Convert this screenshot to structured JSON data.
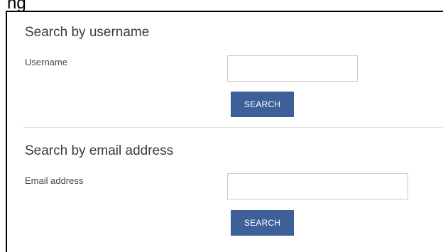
{
  "header_fragment": "ng",
  "username_section": {
    "title": "Search by username",
    "field_label": "Username",
    "input_value": "",
    "button_label": "SEARCH"
  },
  "email_section": {
    "title": "Search by email address",
    "field_label": "Email address",
    "input_value": "",
    "button_label": "SEARCH"
  },
  "colors": {
    "button_background": "#3d6098",
    "button_text": "#ffffff",
    "divider": "#e2e2e2",
    "input_border": "#c9c9c9"
  }
}
